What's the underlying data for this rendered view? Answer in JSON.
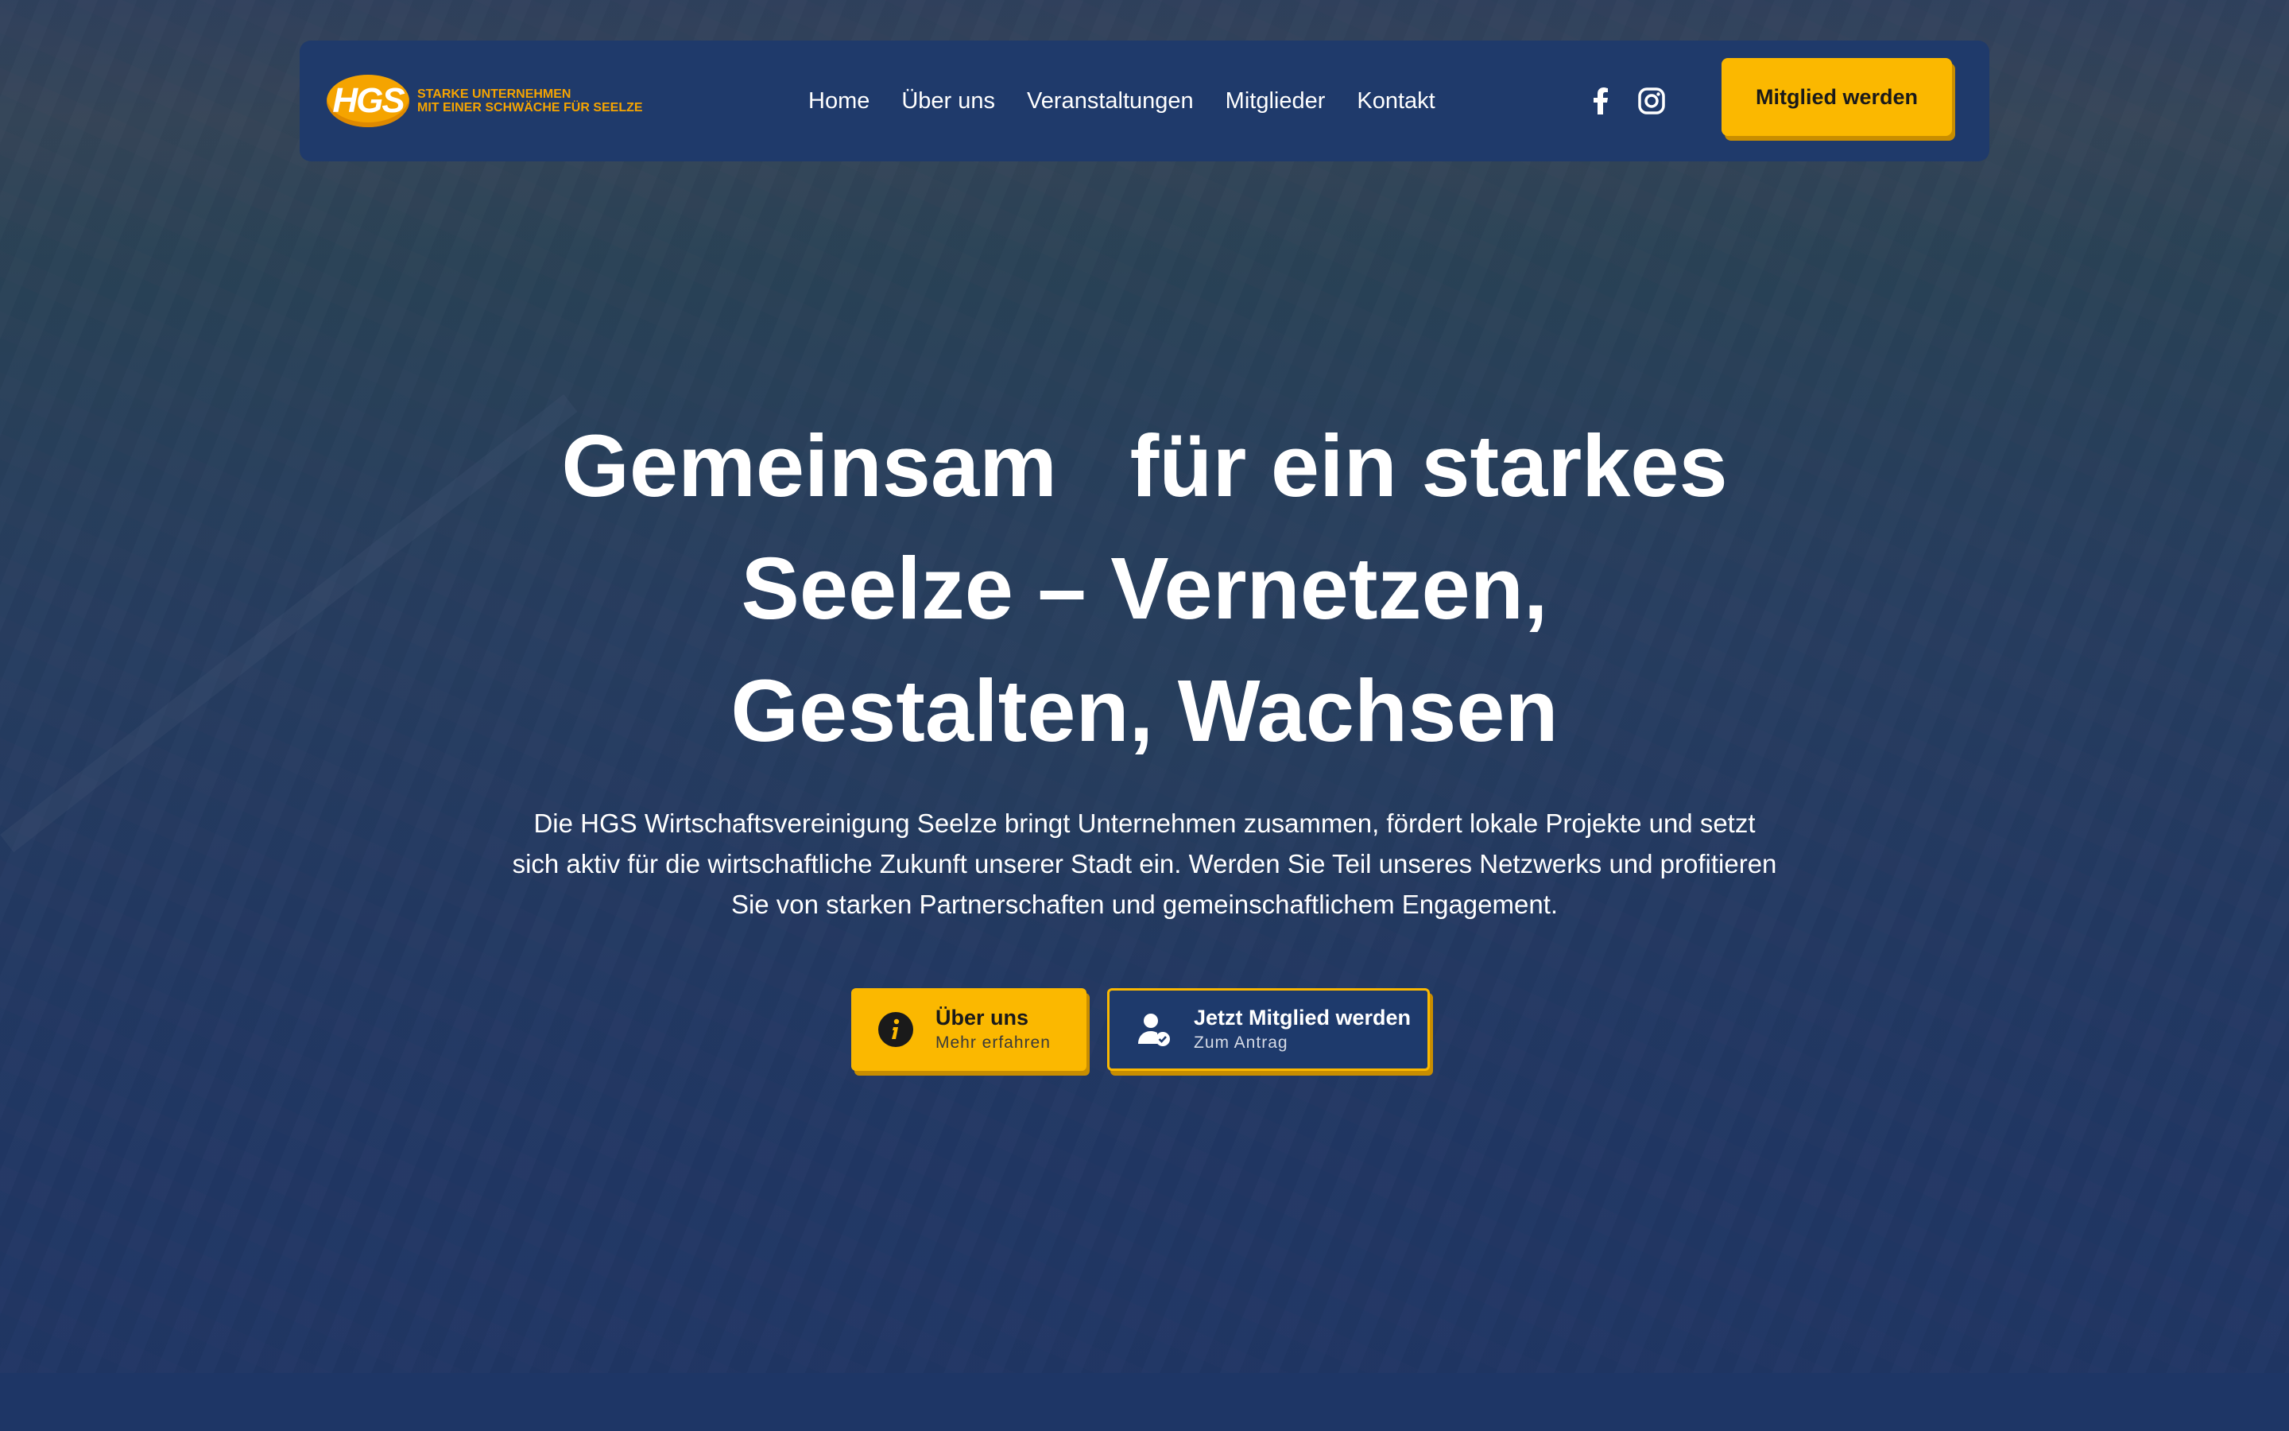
{
  "brand": {
    "logo_text": "HGS",
    "tagline_line1": "STARKE UNTERNEHMEN",
    "tagline_line2": "MIT EINER SCHWÄCHE FÜR SEELZE",
    "accent_color": "#fbb800",
    "navy_color": "#1f3a6b"
  },
  "nav": {
    "links": [
      "Home",
      "Über uns",
      "Veranstaltungen",
      "Mitglieder",
      "Kontakt"
    ],
    "social": [
      "facebook-icon",
      "instagram-icon"
    ],
    "cta_label": "Mitglied werden"
  },
  "hero": {
    "headline_line1": "Gemeinsam   für ein starkes",
    "headline_line2": "Seelze – Vernetzen,",
    "headline_line3": "Gestalten, Wachsen",
    "subtext": "Die HGS Wirtschaftsvereinigung Seelze bringt Unternehmen zusammen, fördert lokale Projekte und setzt sich aktiv für die wirtschaftliche Zukunft unserer Stadt ein. Werden Sie Teil unseres Netzwerks und profitieren Sie von starken Partnerschaften und gemeinschaftlichem Engagement.",
    "buttons": [
      {
        "title": "Über uns",
        "subtitle": "Mehr erfahren",
        "icon": "info-icon"
      },
      {
        "title": "Jetzt Mitglied werden",
        "subtitle": "Zum Antrag",
        "icon": "user-check-icon"
      }
    ]
  }
}
